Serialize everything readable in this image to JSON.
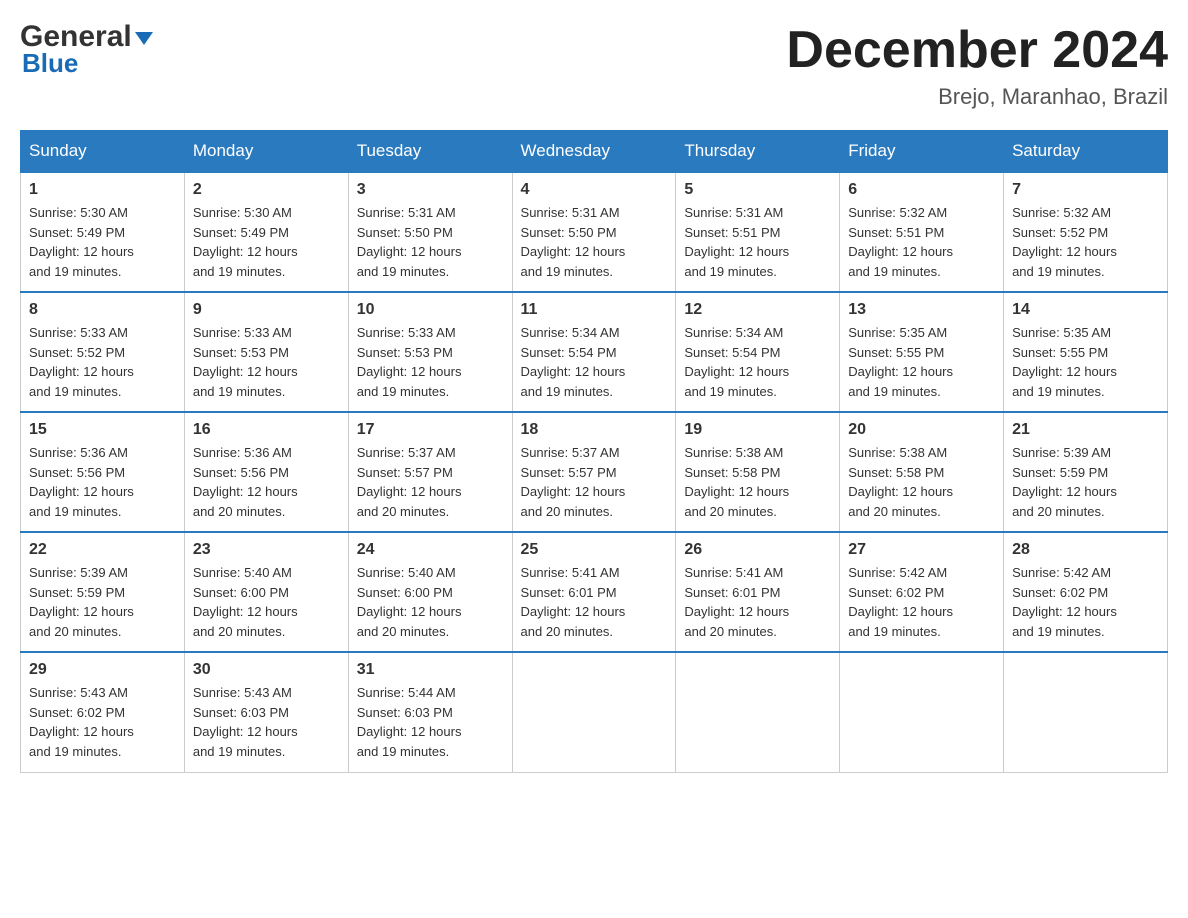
{
  "header": {
    "logo_general": "General",
    "logo_blue": "Blue",
    "month_title": "December 2024",
    "location": "Brejo, Maranhao, Brazil"
  },
  "days_of_week": [
    "Sunday",
    "Monday",
    "Tuesday",
    "Wednesday",
    "Thursday",
    "Friday",
    "Saturday"
  ],
  "weeks": [
    [
      {
        "day": "1",
        "sunrise": "5:30 AM",
        "sunset": "5:49 PM",
        "daylight": "12 hours and 19 minutes."
      },
      {
        "day": "2",
        "sunrise": "5:30 AM",
        "sunset": "5:49 PM",
        "daylight": "12 hours and 19 minutes."
      },
      {
        "day": "3",
        "sunrise": "5:31 AM",
        "sunset": "5:50 PM",
        "daylight": "12 hours and 19 minutes."
      },
      {
        "day": "4",
        "sunrise": "5:31 AM",
        "sunset": "5:50 PM",
        "daylight": "12 hours and 19 minutes."
      },
      {
        "day": "5",
        "sunrise": "5:31 AM",
        "sunset": "5:51 PM",
        "daylight": "12 hours and 19 minutes."
      },
      {
        "day": "6",
        "sunrise": "5:32 AM",
        "sunset": "5:51 PM",
        "daylight": "12 hours and 19 minutes."
      },
      {
        "day": "7",
        "sunrise": "5:32 AM",
        "sunset": "5:52 PM",
        "daylight": "12 hours and 19 minutes."
      }
    ],
    [
      {
        "day": "8",
        "sunrise": "5:33 AM",
        "sunset": "5:52 PM",
        "daylight": "12 hours and 19 minutes."
      },
      {
        "day": "9",
        "sunrise": "5:33 AM",
        "sunset": "5:53 PM",
        "daylight": "12 hours and 19 minutes."
      },
      {
        "day": "10",
        "sunrise": "5:33 AM",
        "sunset": "5:53 PM",
        "daylight": "12 hours and 19 minutes."
      },
      {
        "day": "11",
        "sunrise": "5:34 AM",
        "sunset": "5:54 PM",
        "daylight": "12 hours and 19 minutes."
      },
      {
        "day": "12",
        "sunrise": "5:34 AM",
        "sunset": "5:54 PM",
        "daylight": "12 hours and 19 minutes."
      },
      {
        "day": "13",
        "sunrise": "5:35 AM",
        "sunset": "5:55 PM",
        "daylight": "12 hours and 19 minutes."
      },
      {
        "day": "14",
        "sunrise": "5:35 AM",
        "sunset": "5:55 PM",
        "daylight": "12 hours and 19 minutes."
      }
    ],
    [
      {
        "day": "15",
        "sunrise": "5:36 AM",
        "sunset": "5:56 PM",
        "daylight": "12 hours and 19 minutes."
      },
      {
        "day": "16",
        "sunrise": "5:36 AM",
        "sunset": "5:56 PM",
        "daylight": "12 hours and 20 minutes."
      },
      {
        "day": "17",
        "sunrise": "5:37 AM",
        "sunset": "5:57 PM",
        "daylight": "12 hours and 20 minutes."
      },
      {
        "day": "18",
        "sunrise": "5:37 AM",
        "sunset": "5:57 PM",
        "daylight": "12 hours and 20 minutes."
      },
      {
        "day": "19",
        "sunrise": "5:38 AM",
        "sunset": "5:58 PM",
        "daylight": "12 hours and 20 minutes."
      },
      {
        "day": "20",
        "sunrise": "5:38 AM",
        "sunset": "5:58 PM",
        "daylight": "12 hours and 20 minutes."
      },
      {
        "day": "21",
        "sunrise": "5:39 AM",
        "sunset": "5:59 PM",
        "daylight": "12 hours and 20 minutes."
      }
    ],
    [
      {
        "day": "22",
        "sunrise": "5:39 AM",
        "sunset": "5:59 PM",
        "daylight": "12 hours and 20 minutes."
      },
      {
        "day": "23",
        "sunrise": "5:40 AM",
        "sunset": "6:00 PM",
        "daylight": "12 hours and 20 minutes."
      },
      {
        "day": "24",
        "sunrise": "5:40 AM",
        "sunset": "6:00 PM",
        "daylight": "12 hours and 20 minutes."
      },
      {
        "day": "25",
        "sunrise": "5:41 AM",
        "sunset": "6:01 PM",
        "daylight": "12 hours and 20 minutes."
      },
      {
        "day": "26",
        "sunrise": "5:41 AM",
        "sunset": "6:01 PM",
        "daylight": "12 hours and 20 minutes."
      },
      {
        "day": "27",
        "sunrise": "5:42 AM",
        "sunset": "6:02 PM",
        "daylight": "12 hours and 19 minutes."
      },
      {
        "day": "28",
        "sunrise": "5:42 AM",
        "sunset": "6:02 PM",
        "daylight": "12 hours and 19 minutes."
      }
    ],
    [
      {
        "day": "29",
        "sunrise": "5:43 AM",
        "sunset": "6:02 PM",
        "daylight": "12 hours and 19 minutes."
      },
      {
        "day": "30",
        "sunrise": "5:43 AM",
        "sunset": "6:03 PM",
        "daylight": "12 hours and 19 minutes."
      },
      {
        "day": "31",
        "sunrise": "5:44 AM",
        "sunset": "6:03 PM",
        "daylight": "12 hours and 19 minutes."
      },
      null,
      null,
      null,
      null
    ]
  ],
  "labels": {
    "sunrise": "Sunrise:",
    "sunset": "Sunset:",
    "daylight": "Daylight:"
  }
}
